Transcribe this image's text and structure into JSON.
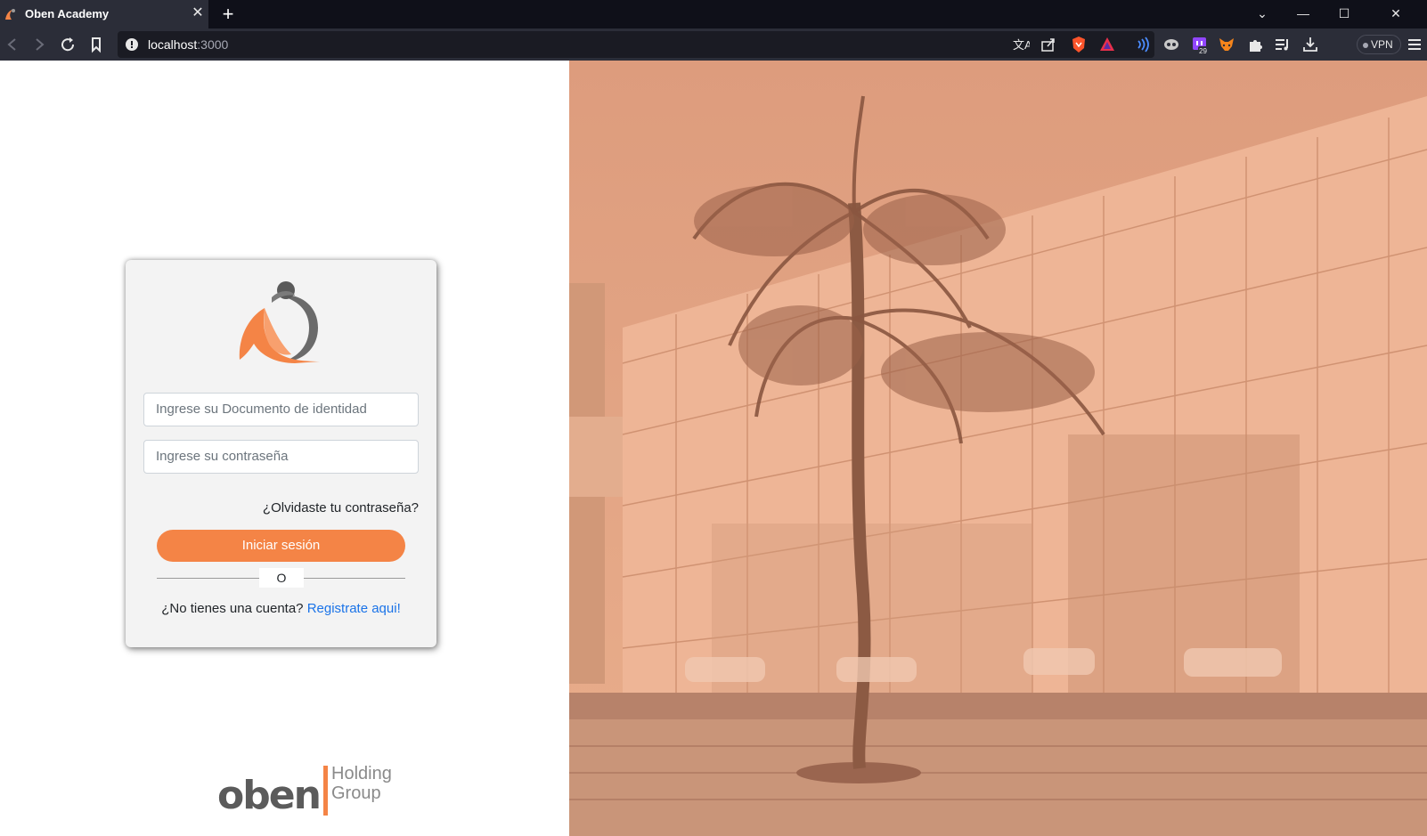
{
  "browser": {
    "tab_title": "Oben Academy",
    "url_host": "localhost",
    "url_port": ":3000",
    "vpn_label": "VPN",
    "extension_badge": "29"
  },
  "login": {
    "document_placeholder": "Ingrese su Documento de identidad",
    "password_placeholder": "Ingrese su contraseña",
    "forgot_password": "¿Olvidaste tu contraseña?",
    "submit_label": "Iniciar sesión",
    "divider_text": "O",
    "no_account_text": "¿No tienes una cuenta?",
    "register_link": "Registrate aqui!"
  },
  "brand": {
    "name": "oben",
    "subtitle_line1": "Holding",
    "subtitle_line2": "Group"
  },
  "colors": {
    "accent": "#f48446",
    "link": "#1a73e8",
    "image_tint": "#e6a887"
  }
}
